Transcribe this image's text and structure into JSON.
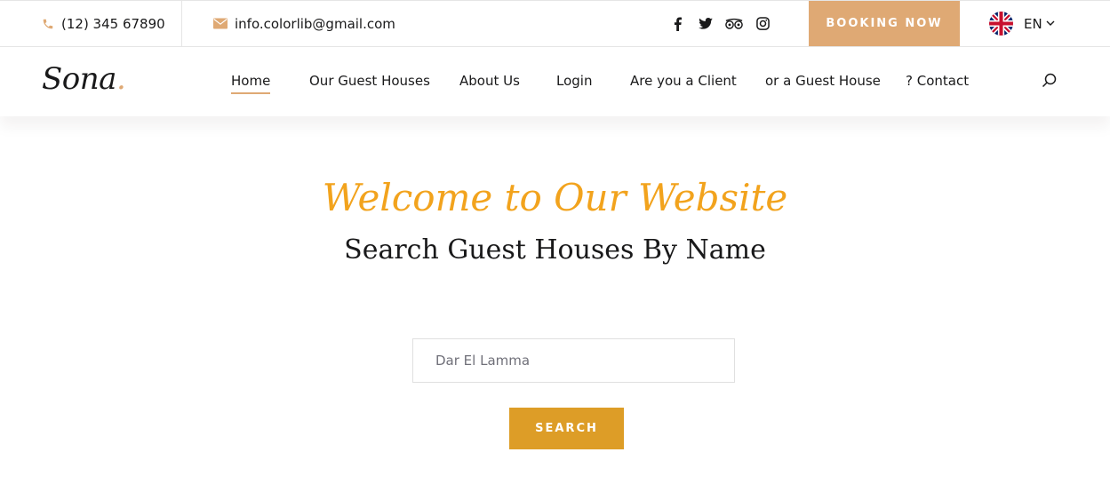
{
  "topbar": {
    "phone": "(12) 345 67890",
    "email": "info.colorlib@gmail.com",
    "social": [
      {
        "icon": "facebook-icon"
      },
      {
        "icon": "twitter-icon"
      },
      {
        "icon": "tripadvisor-icon"
      },
      {
        "icon": "instagram-icon"
      }
    ],
    "booking_label": "Booking Now",
    "language": "EN"
  },
  "navbar": {
    "logo_text": "Sona",
    "logo_dot": ".",
    "menu": [
      {
        "label": "Home",
        "active": true
      },
      {
        "label": "Our Guest Houses"
      },
      {
        "label": "About Us"
      },
      {
        "label": "Login"
      },
      {
        "label": "Are you a Client"
      },
      {
        "label": "or a Guest House"
      },
      {
        "label": "? Contact"
      }
    ]
  },
  "hero": {
    "title": "Welcome to Our Website",
    "subtitle": "Search Guest Houses By Name",
    "search_value": "Dar El Lamma",
    "search_button": "Search"
  },
  "colors": {
    "accent": "#dfa974",
    "title": "#f2a31d",
    "button": "#dd9d27",
    "text": "#19191a"
  }
}
